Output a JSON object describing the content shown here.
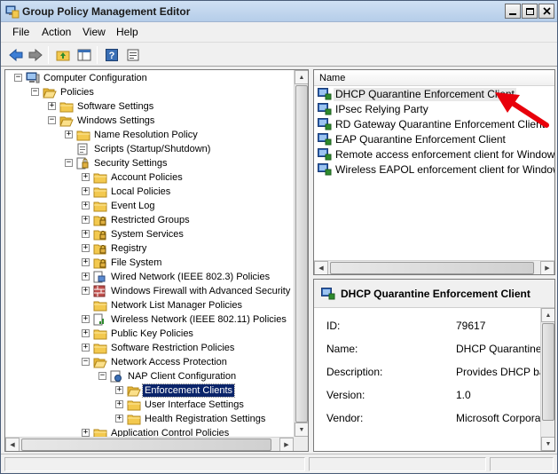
{
  "window": {
    "title": "Group Policy Management Editor"
  },
  "menu": {
    "file": "File",
    "action": "Action",
    "view": "View",
    "help": "Help"
  },
  "tree": [
    {
      "label": "Computer Configuration",
      "level": 0,
      "expander": "−",
      "icon": "computer-icon"
    },
    {
      "label": "Policies",
      "level": 1,
      "expander": "−",
      "icon": "folder-open-icon"
    },
    {
      "label": "Software Settings",
      "level": 2,
      "expander": "+",
      "icon": "folder-icon"
    },
    {
      "label": "Windows Settings",
      "level": 2,
      "expander": "−",
      "icon": "folder-open-icon"
    },
    {
      "label": "Name Resolution Policy",
      "level": 3,
      "expander": "+",
      "icon": "folder-icon"
    },
    {
      "label": "Scripts (Startup/Shutdown)",
      "level": 3,
      "expander": "",
      "icon": "script-icon"
    },
    {
      "label": "Security Settings",
      "level": 3,
      "expander": "−",
      "icon": "security-icon"
    },
    {
      "label": "Account Policies",
      "level": 4,
      "expander": "+",
      "icon": "folder-icon"
    },
    {
      "label": "Local Policies",
      "level": 4,
      "expander": "+",
      "icon": "folder-icon"
    },
    {
      "label": "Event Log",
      "level": 4,
      "expander": "+",
      "icon": "folder-icon"
    },
    {
      "label": "Restricted Groups",
      "level": 4,
      "expander": "+",
      "icon": "folder-lock-icon"
    },
    {
      "label": "System Services",
      "level": 4,
      "expander": "+",
      "icon": "folder-lock-icon"
    },
    {
      "label": "Registry",
      "level": 4,
      "expander": "+",
      "icon": "folder-lock-icon"
    },
    {
      "label": "File System",
      "level": 4,
      "expander": "+",
      "icon": "folder-lock-icon"
    },
    {
      "label": "Wired Network (IEEE 802.3) Policies",
      "level": 4,
      "expander": "+",
      "icon": "network-icon"
    },
    {
      "label": "Windows Firewall with Advanced Security",
      "level": 4,
      "expander": "+",
      "icon": "firewall-icon"
    },
    {
      "label": "Network List Manager Policies",
      "level": 4,
      "expander": "",
      "icon": "folder-icon"
    },
    {
      "label": "Wireless Network (IEEE 802.11) Policies",
      "level": 4,
      "expander": "+",
      "icon": "wireless-icon"
    },
    {
      "label": "Public Key Policies",
      "level": 4,
      "expander": "+",
      "icon": "folder-icon"
    },
    {
      "label": "Software Restriction Policies",
      "level": 4,
      "expander": "+",
      "icon": "folder-icon"
    },
    {
      "label": "Network Access Protection",
      "level": 4,
      "expander": "−",
      "icon": "folder-open-icon"
    },
    {
      "label": "NAP Client Configuration",
      "level": 5,
      "expander": "−",
      "icon": "nap-icon"
    },
    {
      "label": "Enforcement Clients",
      "level": 6,
      "expander": "+",
      "icon": "folder-open-icon",
      "selected": true
    },
    {
      "label": "User Interface Settings",
      "level": 6,
      "expander": "+",
      "icon": "folder-icon"
    },
    {
      "label": "Health Registration Settings",
      "level": 6,
      "expander": "+",
      "icon": "folder-icon"
    },
    {
      "label": "Application Control Policies",
      "level": 4,
      "expander": "+",
      "icon": "folder-icon"
    }
  ],
  "list": {
    "column": "Name",
    "items": [
      "DHCP Quarantine Enforcement Client",
      "IPsec Relying Party",
      "RD Gateway Quarantine Enforcement Client",
      "EAP Quarantine Enforcement Client",
      "Remote access enforcement client for Windows XP",
      "Wireless EAPOL enforcement client for Windows XP"
    ]
  },
  "detail": {
    "title": "DHCP Quarantine Enforcement Client",
    "fields": [
      {
        "label": "ID:",
        "value": "79617"
      },
      {
        "label": "Name:",
        "value": "DHCP Quarantine E"
      },
      {
        "label": "Description:",
        "value": "Provides DHCP bas"
      },
      {
        "label": "Version:",
        "value": "1.0"
      },
      {
        "label": "Vendor:",
        "value": "Microsoft Corporatio"
      }
    ]
  },
  "colors": {
    "selection": "#0a246a",
    "arrow": "#e8000b",
    "titlebar": "#b5cde9"
  }
}
